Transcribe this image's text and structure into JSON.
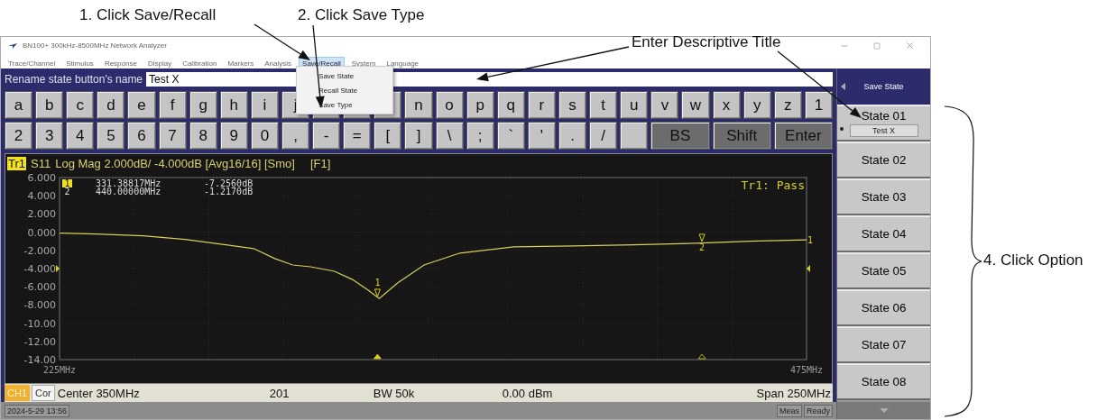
{
  "callouts": [
    {
      "text": "1. Click Save/Recall"
    },
    {
      "text": "2. Click Save Type"
    },
    {
      "text": "Enter Descriptive Title"
    },
    {
      "text": "4. Click Option"
    }
  ],
  "window": {
    "title": "BN100+ 300kHz-8500MHz Network Analyzer"
  },
  "menu": [
    {
      "label": "Trace/Channel",
      "selected": false
    },
    {
      "label": "Stimulus",
      "selected": false
    },
    {
      "label": "Response",
      "selected": false
    },
    {
      "label": "Display",
      "selected": false
    },
    {
      "label": "Calibration",
      "selected": false
    },
    {
      "label": "Markers",
      "selected": false
    },
    {
      "label": "Analysis",
      "selected": false
    },
    {
      "label": "Save/Recall",
      "selected": true
    },
    {
      "label": "System",
      "selected": false
    },
    {
      "label": "Language",
      "selected": false
    }
  ],
  "dropdown": {
    "items": [
      "Save State",
      "Recall State",
      "Save Type"
    ]
  },
  "rename": {
    "label": "Rename state button's name",
    "value": "Test X"
  },
  "keyboard": [
    [
      {
        "kind": "char",
        "label": "a"
      },
      {
        "kind": "char",
        "label": "b"
      },
      {
        "kind": "char",
        "label": "c"
      },
      {
        "kind": "char",
        "label": "d"
      },
      {
        "kind": "char",
        "label": "e"
      },
      {
        "kind": "char",
        "label": "f"
      },
      {
        "kind": "char",
        "label": "g"
      },
      {
        "kind": "char",
        "label": "h"
      },
      {
        "kind": "char",
        "label": "i"
      },
      {
        "kind": "char",
        "label": "j"
      },
      {
        "kind": "blank"
      },
      {
        "kind": "blank"
      },
      {
        "kind": "blank"
      },
      {
        "kind": "char",
        "label": "n"
      },
      {
        "kind": "char",
        "label": "o"
      },
      {
        "kind": "char",
        "label": "p"
      },
      {
        "kind": "char",
        "label": "q"
      },
      {
        "kind": "char",
        "label": "r"
      },
      {
        "kind": "char",
        "label": "s"
      },
      {
        "kind": "char",
        "label": "t"
      },
      {
        "kind": "char",
        "label": "u"
      },
      {
        "kind": "char",
        "label": "v"
      },
      {
        "kind": "char",
        "label": "w"
      },
      {
        "kind": "char",
        "label": "x"
      },
      {
        "kind": "char",
        "label": "y"
      },
      {
        "kind": "char",
        "label": "z"
      },
      {
        "kind": "char",
        "label": "1"
      }
    ],
    [
      {
        "kind": "char",
        "label": "2"
      },
      {
        "kind": "char",
        "label": "3"
      },
      {
        "kind": "char",
        "label": "4"
      },
      {
        "kind": "char",
        "label": "5"
      },
      {
        "kind": "char",
        "label": "6"
      },
      {
        "kind": "char",
        "label": "7"
      },
      {
        "kind": "char",
        "label": "8"
      },
      {
        "kind": "char",
        "label": "9"
      },
      {
        "kind": "char",
        "label": "0"
      },
      {
        "kind": "char",
        "label": ","
      },
      {
        "kind": "char",
        "label": "-"
      },
      {
        "kind": "char",
        "label": "="
      },
      {
        "kind": "char",
        "label": "["
      },
      {
        "kind": "char",
        "label": "]"
      },
      {
        "kind": "char",
        "label": "\\"
      },
      {
        "kind": "char",
        "label": ";"
      },
      {
        "kind": "char",
        "label": "`"
      },
      {
        "kind": "char",
        "label": "'"
      },
      {
        "kind": "char",
        "label": "."
      },
      {
        "kind": "char",
        "label": "/"
      },
      {
        "kind": "blank"
      },
      {
        "kind": "action",
        "label": "BS"
      },
      {
        "kind": "action",
        "label": "Shift"
      },
      {
        "kind": "action",
        "label": "Enter"
      }
    ]
  ],
  "trace": {
    "badge": "Tr1",
    "heading": "Log Mag 2.000dB/ -4.000dB [Avg16/16] [Smo]",
    "function": "[F1]",
    "limit_result": "Tr1: Pass",
    "end_label": "1",
    "markers": [
      {
        "number": "1",
        "trace_label": "1",
        "frequency": "331.38817MHz",
        "value": "-7.2560dB",
        "selected": true
      },
      {
        "number": "2",
        "trace_label": "2",
        "frequency": "440.00000MHz",
        "value": "-1.2170dB",
        "selected": false
      }
    ],
    "chart_data": {
      "type": "line",
      "x": [
        225,
        237,
        253,
        267,
        290,
        297,
        303,
        309,
        317,
        323,
        328,
        332,
        338,
        347,
        359,
        377,
        397,
        417,
        440,
        456,
        475
      ],
      "series": [
        {
          "name": "S11",
          "color": "#d6cf5a",
          "values": [
            -0.1,
            -0.2,
            -0.4,
            -0.8,
            -1.8,
            -2.9,
            -3.6,
            -3.8,
            -4.3,
            -5.2,
            -6.3,
            -7.3,
            -5.6,
            -3.6,
            -2.3,
            -1.6,
            -1.5,
            -1.4,
            -1.2,
            -1.0,
            -0.85
          ]
        }
      ],
      "xlim": [
        225,
        475
      ],
      "ylim": [
        -14,
        6
      ],
      "xticks": [
        {
          "value": 225,
          "label": "225MHz"
        },
        {
          "value": 475,
          "label": "475MHz"
        }
      ],
      "grid": true,
      "yticks": [
        {
          "value": 6,
          "label": "6.000"
        },
        {
          "value": 4,
          "label": "4.000"
        },
        {
          "value": 2,
          "label": "2.000"
        },
        {
          "value": 0,
          "label": "0.000"
        },
        {
          "value": -2,
          "label": "-2.000"
        },
        {
          "value": -4,
          "label": "-4.000"
        },
        {
          "value": -6,
          "label": "-6.000"
        },
        {
          "value": -8,
          "label": "-8.000"
        },
        {
          "value": -10,
          "label": "-10.00"
        },
        {
          "value": -12,
          "label": "-12.00"
        },
        {
          "value": -14,
          "label": "-14.00"
        }
      ]
    }
  },
  "status": {
    "channel": "CH1",
    "correction": "Cor",
    "center": "Center 350MHz",
    "points": "201",
    "bandwidth": "BW 50k",
    "power": "0.00 dBm",
    "span": "Span 250MHz"
  },
  "footer": {
    "datetime": "2024-5-29 13:56",
    "mode": "Meas",
    "state": "Ready"
  },
  "softkeys": {
    "title": "Save State",
    "items": [
      {
        "label": "State 01",
        "name": "Test X",
        "selected": true
      },
      {
        "label": "State 02",
        "selected": false
      },
      {
        "label": "State 03",
        "selected": false
      },
      {
        "label": "State 04",
        "selected": false
      },
      {
        "label": "State 05",
        "selected": false
      },
      {
        "label": "State 06",
        "selected": false
      },
      {
        "label": "State 07",
        "selected": false
      },
      {
        "label": "State 08",
        "selected": false
      }
    ]
  }
}
